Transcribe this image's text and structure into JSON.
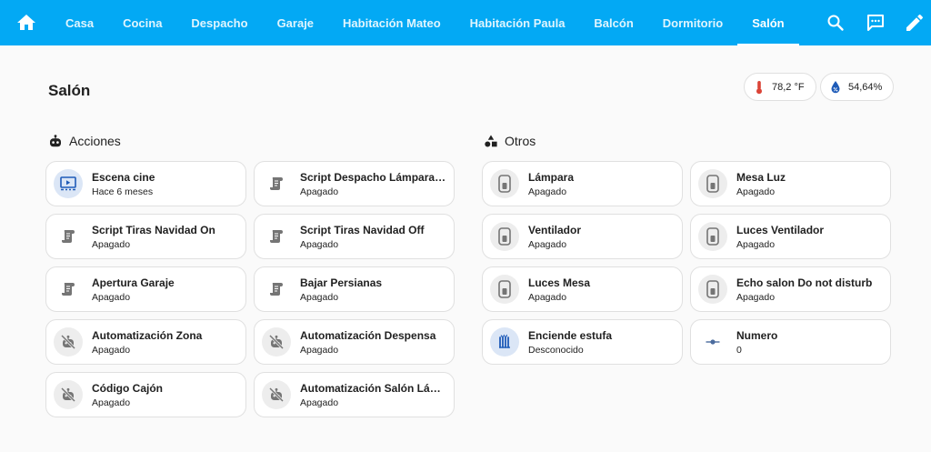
{
  "topbar": {
    "tabs": [
      {
        "label": "Casa"
      },
      {
        "label": "Cocina"
      },
      {
        "label": "Despacho"
      },
      {
        "label": "Garaje"
      },
      {
        "label": "Habitación Mateo"
      },
      {
        "label": "Habitación Paula"
      },
      {
        "label": "Balcón"
      },
      {
        "label": "Dormitorio"
      },
      {
        "label": "Salón"
      }
    ],
    "active_tab": "Salón",
    "accent": "#03a9f4"
  },
  "view": {
    "title": "Salón",
    "badges": [
      {
        "icon": "thermometer-icon",
        "value": "78,2 °F",
        "color": "#db4437"
      },
      {
        "icon": "water-percent-icon",
        "value": "54,64%",
        "color": "#1e5bb8"
      }
    ]
  },
  "sections": {
    "acciones": {
      "title": "Acciones",
      "icon": "robot-icon",
      "tiles": [
        {
          "name": "Escena cine",
          "state": "Hace 6 meses",
          "icon": "palette-scene-icon"
        },
        {
          "name": "Script Despacho Lámpara Escritorio",
          "state": "Apagado",
          "icon": "script-icon"
        },
        {
          "name": "Script Tiras Navidad On",
          "state": "Apagado",
          "icon": "script-icon"
        },
        {
          "name": "Script Tiras Navidad Off",
          "state": "Apagado",
          "icon": "script-icon"
        },
        {
          "name": "Apertura Garaje",
          "state": "Apagado",
          "icon": "script-icon"
        },
        {
          "name": "Bajar Persianas",
          "state": "Apagado",
          "icon": "script-icon"
        },
        {
          "name": "Automatización Zona",
          "state": "Apagado",
          "icon": "robot-off-icon"
        },
        {
          "name": "Automatización Despensa",
          "state": "Apagado",
          "icon": "robot-off-icon"
        },
        {
          "name": "Código Cajón",
          "state": "Apagado",
          "icon": "robot-off-icon"
        },
        {
          "name": "Automatización Salón Lámpara",
          "state": "Apagado",
          "icon": "robot-off-icon"
        }
      ]
    },
    "otros": {
      "title": "Otros",
      "icon": "shape-icon",
      "tiles": [
        {
          "name": "Lámpara",
          "state": "Apagado",
          "icon": "switch-icon"
        },
        {
          "name": "Mesa Luz",
          "state": "Apagado",
          "icon": "switch-icon"
        },
        {
          "name": "Ventilador",
          "state": "Apagado",
          "icon": "switch-icon"
        },
        {
          "name": "Luces Ventilador",
          "state": "Apagado",
          "icon": "switch-icon"
        },
        {
          "name": "Luces Mesa",
          "state": "Apagado",
          "icon": "switch-icon"
        },
        {
          "name": "Echo salon Do not disturb",
          "state": "Apagado",
          "icon": "switch-icon"
        },
        {
          "name": "Enciende estufa",
          "state": "Desconocido",
          "icon": "radiator-icon"
        },
        {
          "name": "Numero",
          "state": "0",
          "icon": "ray-vertex-icon"
        }
      ]
    }
  }
}
